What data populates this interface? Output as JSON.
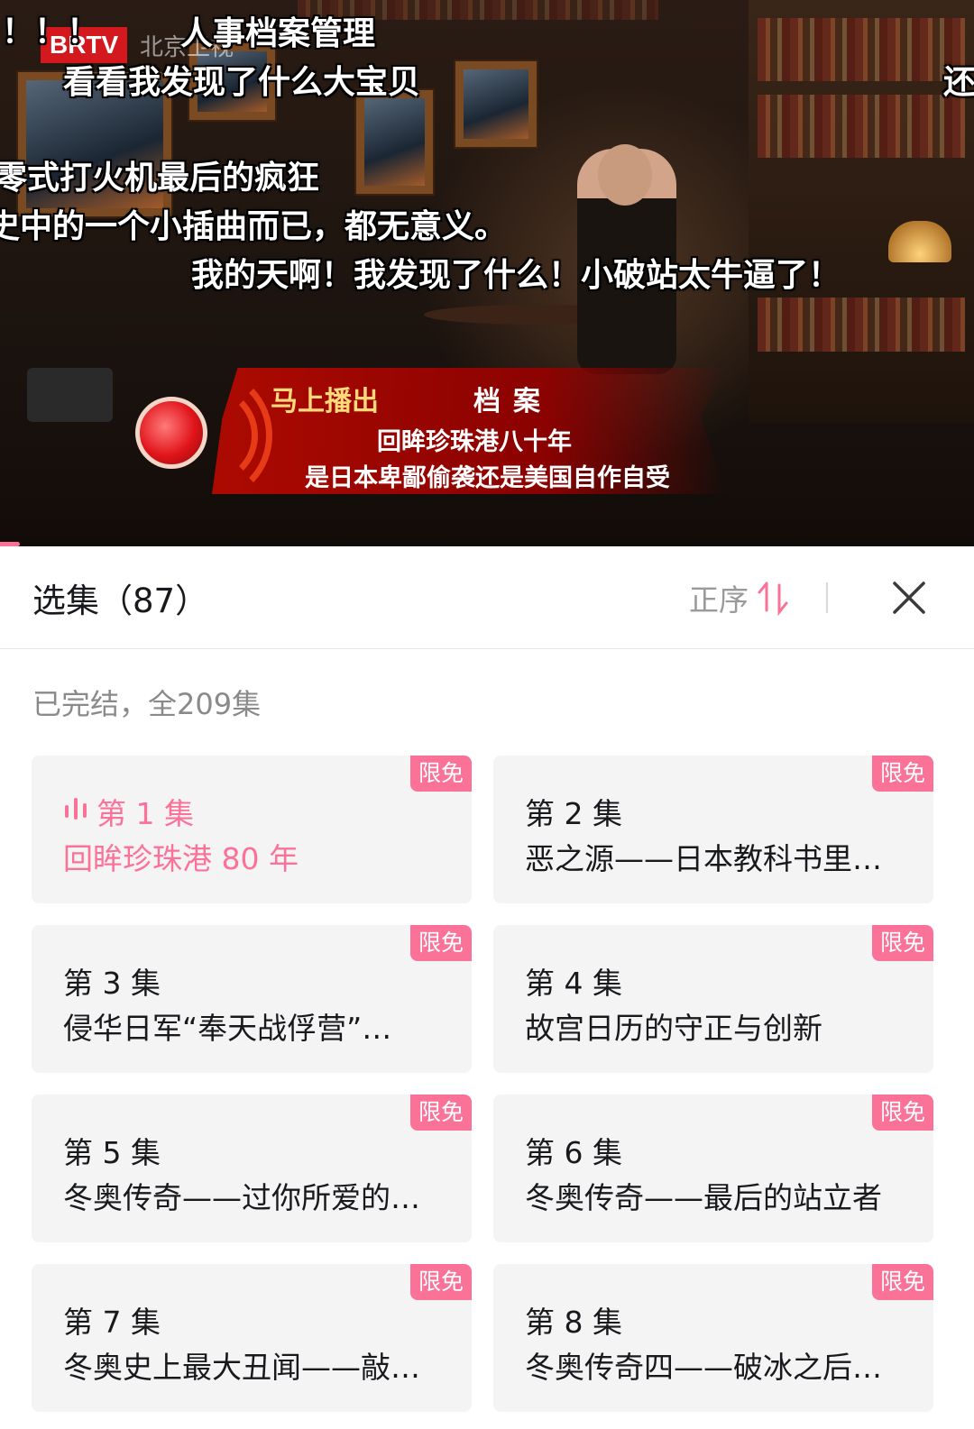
{
  "video": {
    "logo": "BRTV",
    "logo_sub": "北京卫视",
    "danmaku": [
      "！！！",
      "人事档案管理",
      "看看我发现了什么大宝贝",
      "还",
      "零式打火机最后的疯狂",
      "史中的一个小插曲而已，都无意义。",
      "我的天啊！我发现了什么！小破站太牛逼了！"
    ],
    "banner": {
      "upcoming": "马上播出",
      "program": "档案",
      "line1": "回眸珍珠港八十年",
      "line2": "是日本卑鄙偷袭还是美国自作自受"
    }
  },
  "panel": {
    "title": "选集（87）",
    "order_label": "正序",
    "summary": "已完结，全209集",
    "badge_label": "限免",
    "episodes": [
      {
        "num": "第 1 集",
        "title": "回眸珍珠港 80 年",
        "active": true
      },
      {
        "num": "第 2 集",
        "title": "恶之源——日本教科书里…"
      },
      {
        "num": "第 3 集",
        "title": "侵华日军“奉天战俘营”…"
      },
      {
        "num": "第 4 集",
        "title": "故宫日历的守正与创新"
      },
      {
        "num": "第 5 集",
        "title": "冬奥传奇——过你所爱的…"
      },
      {
        "num": "第 6 集",
        "title": "冬奥传奇——最后的站立者"
      },
      {
        "num": "第 7 集",
        "title": "冬奥史上最大丑闻——敲…"
      },
      {
        "num": "第 8 集",
        "title": "冬奥传奇四——破冰之后…"
      }
    ]
  },
  "colors": {
    "accent": "#fb7299",
    "text_primary": "#18191c",
    "text_secondary": "#8a8a8a",
    "card_bg": "#f4f4f5"
  }
}
